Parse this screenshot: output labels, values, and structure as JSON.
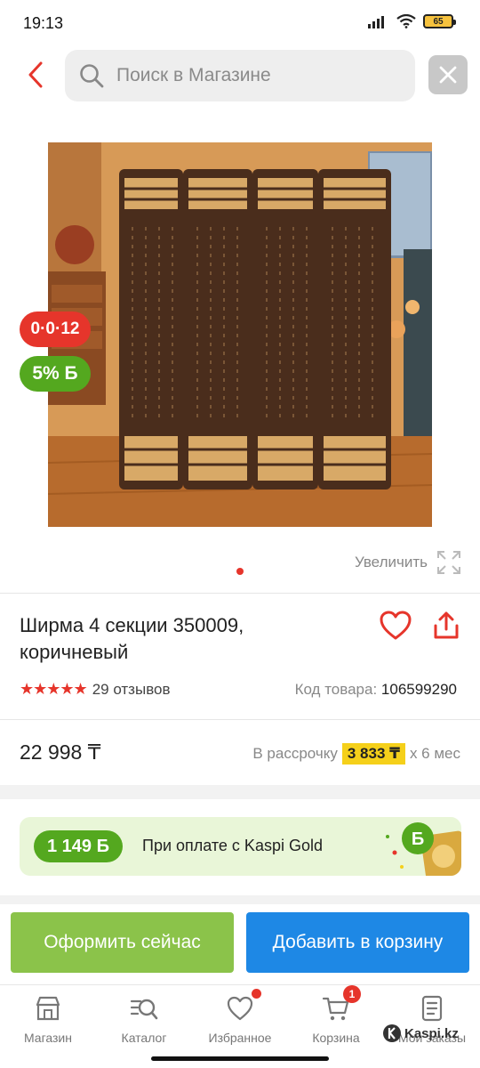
{
  "status_bar": {
    "time": "19:13",
    "battery": "65"
  },
  "header": {
    "search_placeholder": "Поиск в Магазине"
  },
  "gallery": {
    "installment_badge": "0·0·12",
    "bonus_badge": "5% Б",
    "zoom_label": "Увеличить"
  },
  "product": {
    "title": "Ширма 4 секции 350009, коричневый",
    "rating_stars": "★★★★★",
    "reviews": "29 отзывов",
    "sku_label": "Код товара:",
    "sku_value": "106599290",
    "price": "22 998 ₸",
    "installment_prefix": "В рассрочку",
    "installment_amount": "3 833 ₸",
    "installment_suffix": "x 6 мес"
  },
  "gold_banner": {
    "bonus": "1 149 Б",
    "text": "При оплате с Kaspi Gold"
  },
  "actions": {
    "buy_now": "Оформить сейчас",
    "add_to_cart": "Добавить в корзину"
  },
  "bottom_nav": {
    "items": [
      {
        "label": "Магазин",
        "icon": "store-icon"
      },
      {
        "label": "Каталог",
        "icon": "catalog-search-icon"
      },
      {
        "label": "Избранное",
        "icon": "heart-icon"
      },
      {
        "label": "Корзина",
        "icon": "cart-icon"
      },
      {
        "label": "Мои заказы",
        "icon": "orders-icon"
      }
    ],
    "cart_count": "1"
  },
  "watermark": "Kaspi.kz",
  "colors": {
    "accent_red": "#e6352b",
    "bonus_green": "#54a81f",
    "buy_now_green": "#8bc34a",
    "cart_blue": "#1e88e5",
    "installment_yellow": "#f5d01a"
  }
}
